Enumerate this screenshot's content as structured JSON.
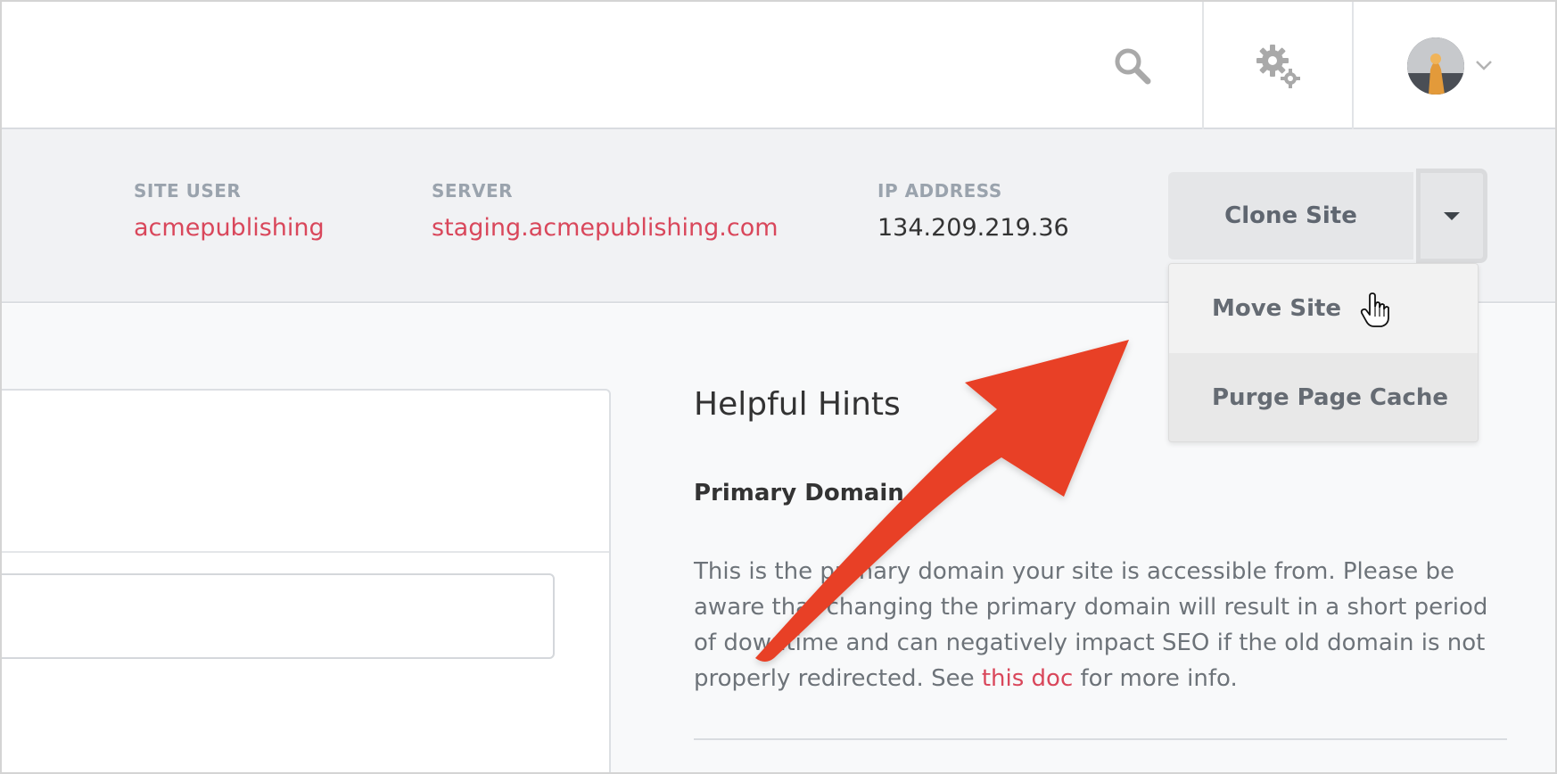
{
  "site_info": {
    "site_user": {
      "label": "SITE USER",
      "value": "acmepublishing"
    },
    "server": {
      "label": "SERVER",
      "value": "staging.acmepublishing.com"
    },
    "ip_address": {
      "label": "IP ADDRESS",
      "value": "134.209.219.36"
    }
  },
  "actions": {
    "clone_label": "Clone Site",
    "dropdown_items": [
      {
        "label": "Move Site"
      },
      {
        "label": "Purge Page Cache"
      }
    ]
  },
  "hints": {
    "title": "Helpful Hints",
    "subtitle": "Primary Domain",
    "body_text": "This is the primary domain your site is accessible from. Please be aware that changing the primary domain will result in a short period of downtime and can negatively impact SEO if the old domain is not properly redirected. See ",
    "link_text": "this doc",
    "body_suffix": " for more info."
  },
  "icons": {
    "search": "search-icon",
    "settings": "gear-icon",
    "account_menu": "chevron-down-icon",
    "cursor": "hand-cursor-icon"
  },
  "colors": {
    "accent_link": "#d9475b",
    "annotation_arrow": "#e84027",
    "infobar_bg": "#f1f2f4"
  }
}
